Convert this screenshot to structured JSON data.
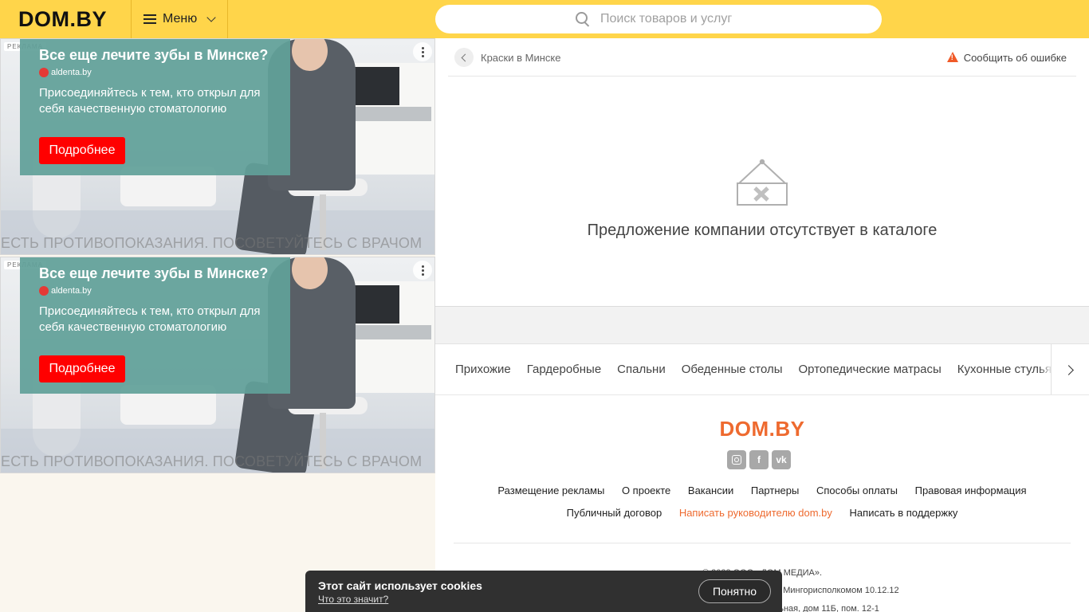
{
  "header": {
    "logo": "DOM.BY",
    "menu_label": "Меню",
    "search_placeholder": "Поиск товаров и услуг"
  },
  "ads": [
    {
      "badge": "РЕКЛАМА",
      "title": "Все еще лечите зубы в Минске?",
      "domain": "aldenta.by",
      "text": "Присоединяйтесь к тем, кто открыл для себя качественную стоматологию",
      "cta": "Подробнее",
      "disclaimer": "ЕСТЬ ПРОТИВОПОКАЗАНИЯ. ПОСОВЕТУЙТЕСЬ С ВРАЧОМ"
    },
    {
      "badge": "РЕКЛАМА",
      "title": "Все еще лечите зубы в Минске?",
      "domain": "aldenta.by",
      "text": "Присоединяйтесь к тем, кто открыл для себя качественную стоматологию",
      "cta": "Подробнее",
      "disclaimer": "ЕСТЬ ПРОТИВОПОКАЗАНИЯ. ПОСОВЕТУЙТЕСЬ С ВРАЧОМ"
    }
  ],
  "breadcrumb": {
    "label": "Краски в Минске",
    "report": "Сообщить об ошибке"
  },
  "empty_state": {
    "message": "Предложение компании отсутствует в каталоге"
  },
  "categories": [
    "Прихожие",
    "Гардеробные",
    "Спальни",
    "Обеденные столы",
    "Ортопедические матрасы",
    "Кухонные стулья"
  ],
  "footer": {
    "logo": "DOM.BY",
    "links_row1": [
      "Размещение рекламы",
      "О проекте",
      "Вакансии",
      "Партнеры",
      "Способы оплаты",
      "Правовая информация"
    ],
    "links_row2": [
      "Публичный договор",
      "Написать руководителю dom.by",
      "Написать в поддержку"
    ],
    "small_1": "© 2023 ООО «ДОМ МЕДИА».",
    "small_2": "Свидетельство о регистрации выдано Мингорисполкомом 10.12.12",
    "small_3": "Юр. адрес: г. Минск, ул. Центральная, дом 11Б, пом. 12-1"
  },
  "cookie": {
    "title": "Этот сайт использует cookies",
    "link": "Что это значит?",
    "button": "Понятно"
  },
  "colors": {
    "header_bg": "#ffd54a",
    "accent_orange": "#ee6a2f",
    "ad_card": "#61a099",
    "ad_cta": "#ff0000"
  }
}
